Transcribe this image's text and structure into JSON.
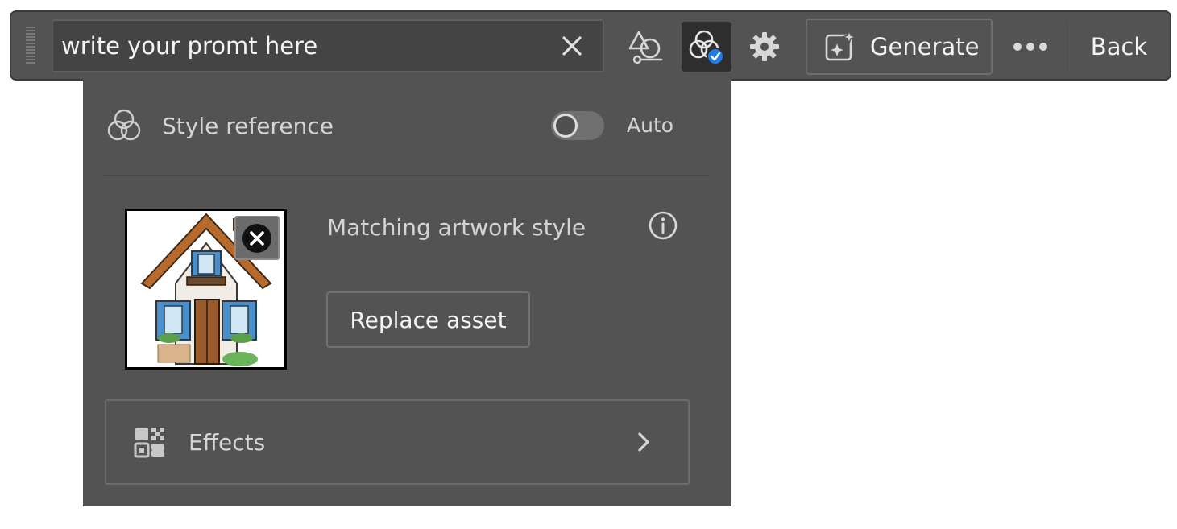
{
  "toolbar": {
    "prompt_value": "write your promt here",
    "clear_icon": "close-icon",
    "shape_icon": "shape-composition-icon",
    "style_icon": "style-reference-icon",
    "settings_icon": "gear-icon",
    "generate_label": "Generate",
    "generate_icon": "generate-sparkle-icon",
    "more_icon": "more-horizontal-icon",
    "back_label": "Back",
    "accent_color": "#1e7ee5"
  },
  "panel": {
    "style_reference_label": "Style reference",
    "toggle_label": "Auto",
    "toggle_on": false,
    "matching_label": "Matching artwork style",
    "replace_label": "Replace asset",
    "effects_label": "Effects"
  }
}
